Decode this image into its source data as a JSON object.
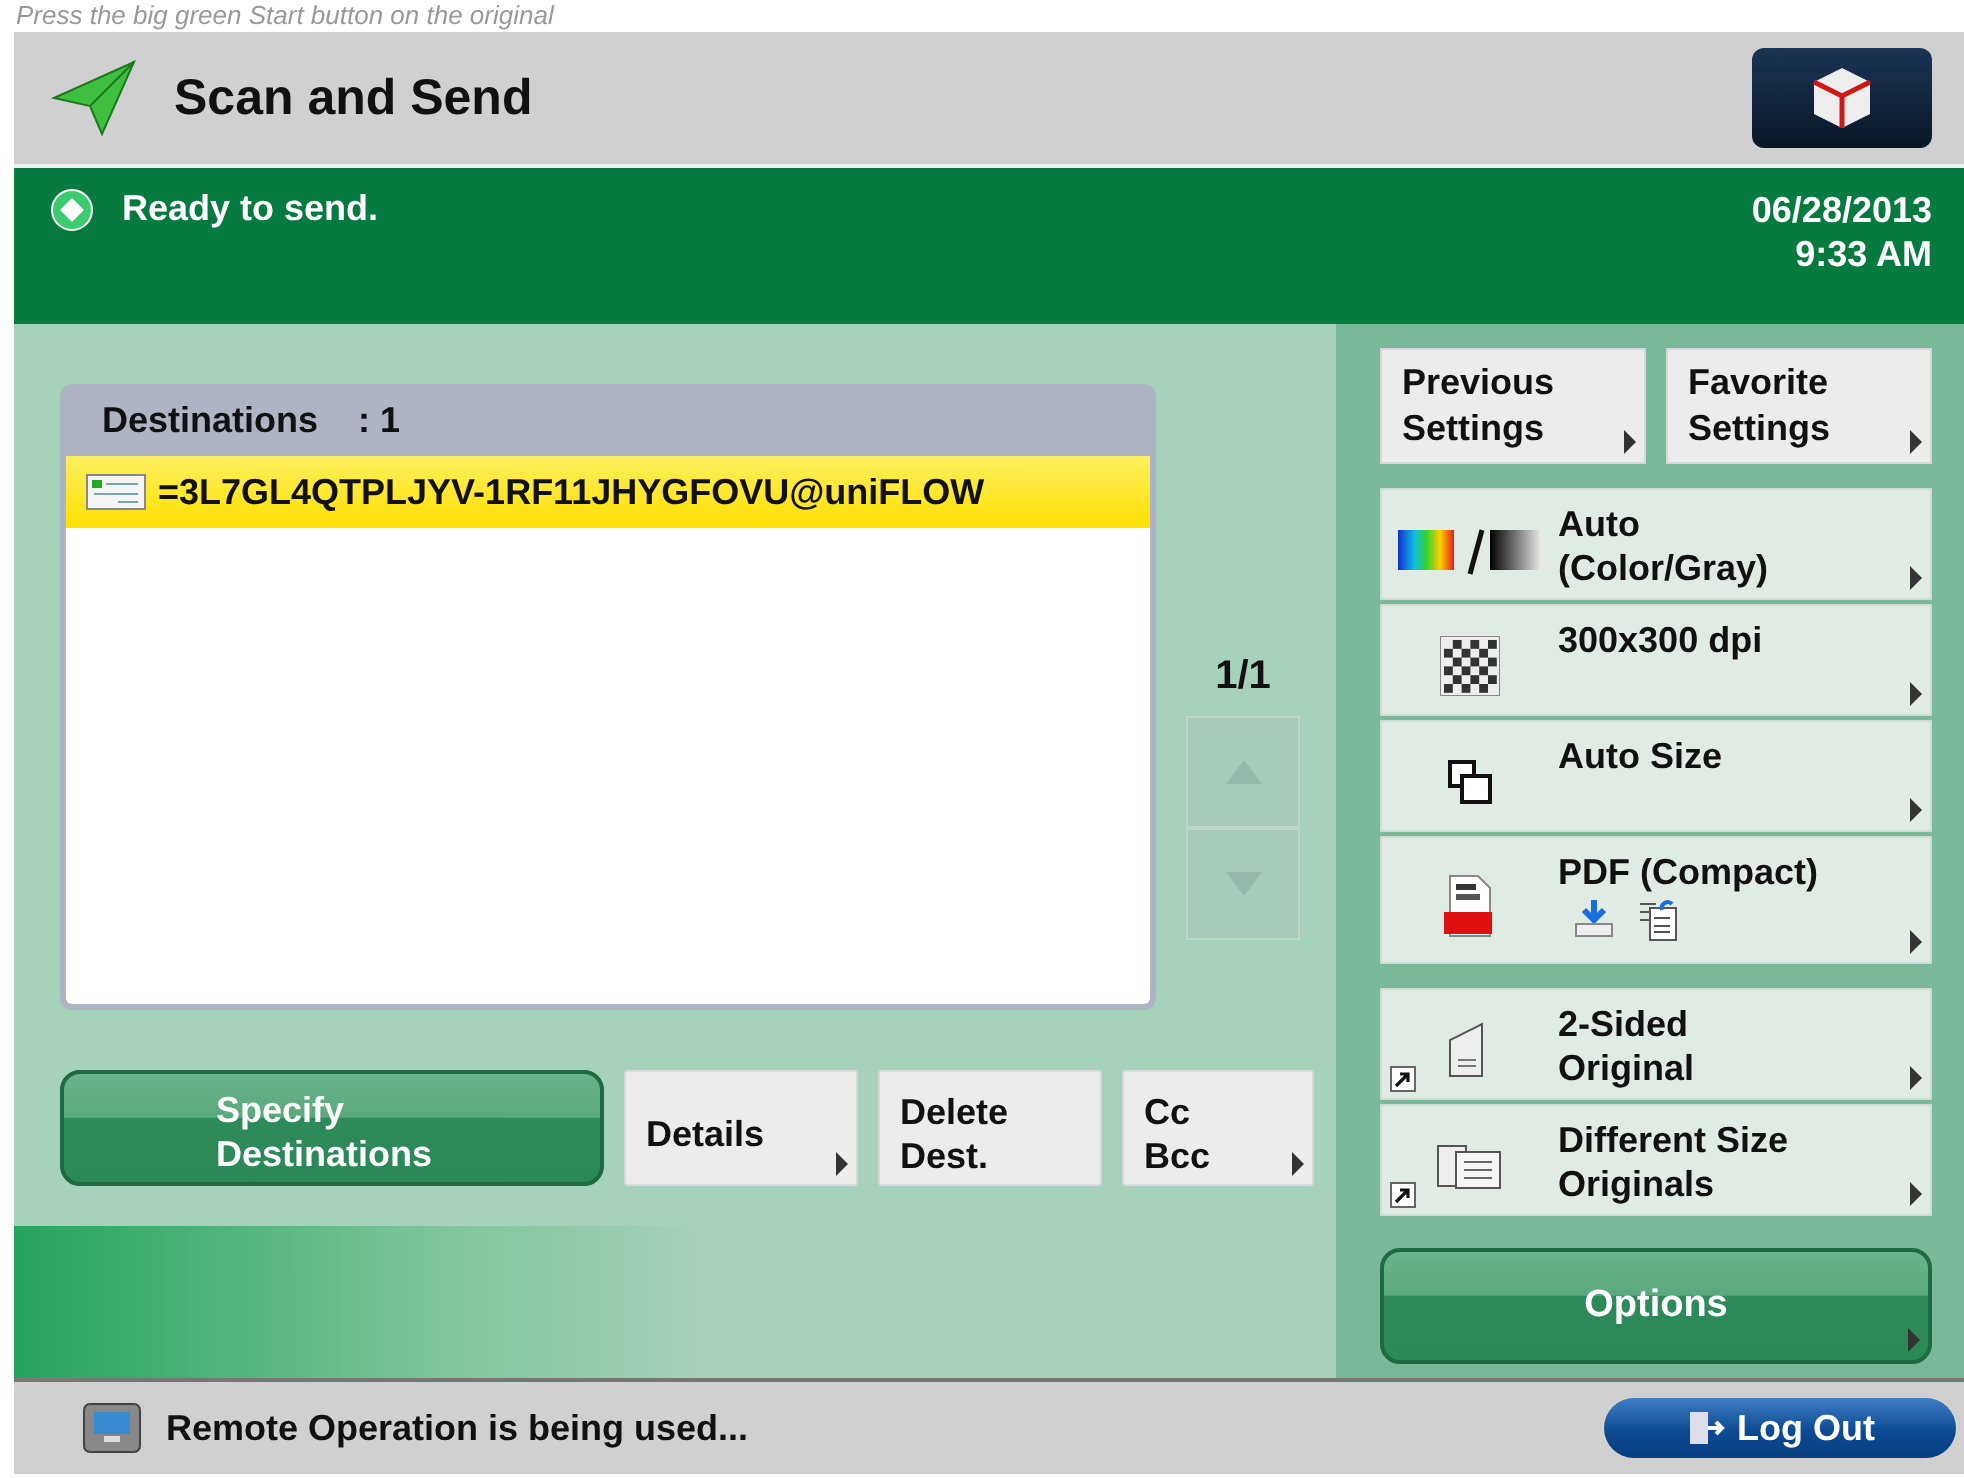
{
  "caption": "Press the big green Start button on the original",
  "header": {
    "title": "Scan and Send"
  },
  "status": {
    "message": "Ready to send.",
    "date": "06/28/2013",
    "time": "9:33 AM"
  },
  "destinations": {
    "label": "Destinations",
    "count": ": 1",
    "page": "1/1",
    "items": [
      {
        "address": "=3L7GL4QTPLJYV-1RF11JHYGFOVU@uniFLOW",
        "selected": true
      }
    ],
    "scroll_buttons": [
      {
        "kind": "up",
        "disabled": true
      },
      {
        "kind": "down",
        "disabled": true
      }
    ]
  },
  "actions": [
    {
      "label": "Specify\nDestinations",
      "kind": "primary"
    },
    {
      "label": "Details",
      "kind": "submenu"
    },
    {
      "label": "Delete\nDest.",
      "kind": "plain"
    },
    {
      "label": "Cc\nBcc",
      "kind": "submenu"
    }
  ],
  "quick_settings": [
    {
      "label": "Previous\nSettings"
    },
    {
      "label": "Favorite\nSettings"
    }
  ],
  "setting_groups": [
    [
      {
        "label": "Auto\n(Color/Gray)",
        "kind": "color",
        "shortcut": false
      },
      {
        "label": "300x300 dpi",
        "kind": "resolution",
        "shortcut": false
      },
      {
        "label": "Auto Size",
        "kind": "size",
        "shortcut": false
      },
      {
        "label": "PDF (Compact)",
        "kind": "format",
        "shortcut": false
      }
    ],
    [
      {
        "label": "2-Sided\nOriginal",
        "kind": "duplex",
        "shortcut": true
      },
      {
        "label": "Different Size\nOriginals",
        "kind": "mixed",
        "shortcut": true
      }
    ]
  ],
  "options": {
    "label": "Options"
  },
  "footer": {
    "message": "Remote Operation is being used...",
    "logout": "Log Out"
  }
}
